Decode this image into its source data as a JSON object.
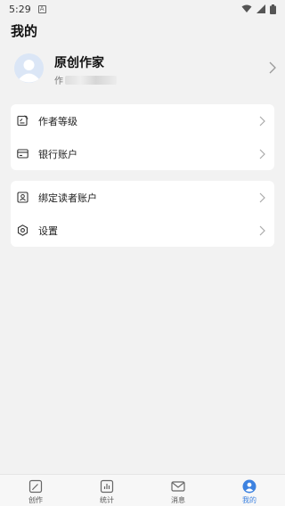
{
  "status_bar": {
    "time": "5:29",
    "app_badge": "A"
  },
  "page": {
    "title": "我的"
  },
  "profile": {
    "name": "原创作家",
    "subtitle": "作"
  },
  "menu_groups": [
    {
      "items": [
        {
          "label": "作者等级",
          "icon": "level-edit-icon"
        },
        {
          "label": "银行账户",
          "icon": "bank-card-icon"
        }
      ]
    },
    {
      "items": [
        {
          "label": "绑定读者账户",
          "icon": "bind-reader-icon"
        },
        {
          "label": "设置",
          "icon": "settings-gear-icon"
        }
      ]
    }
  ],
  "tabbar": {
    "tabs": [
      {
        "label": "创作",
        "icon": "create-icon",
        "active": false
      },
      {
        "label": "统计",
        "icon": "stats-icon",
        "active": false
      },
      {
        "label": "消息",
        "icon": "message-icon",
        "active": false
      },
      {
        "label": "我的",
        "icon": "profile-icon",
        "active": true
      }
    ]
  },
  "colors": {
    "accent": "#3d82e0",
    "background": "#f2f2f2",
    "card": "#ffffff"
  }
}
